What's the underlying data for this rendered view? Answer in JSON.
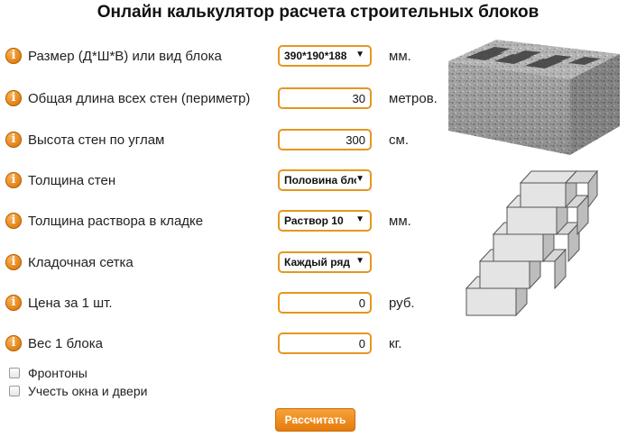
{
  "title": "Онлайн калькулятор расчета строительных блоков",
  "rows": [
    {
      "label": "Размер (Д*Ш*В) или вид блока",
      "type": "select",
      "value": "390*190*188",
      "unit": "мм."
    },
    {
      "label": "Общая длина всех стен (периметр)",
      "type": "input",
      "value": "30",
      "unit": "метров."
    },
    {
      "label": "Высота стен по углам",
      "type": "input",
      "value": "300",
      "unit": "см."
    },
    {
      "label": "Толщина стен",
      "type": "select",
      "value": "Половина блока",
      "unit": ""
    },
    {
      "label": "Толщина раствора в кладке",
      "type": "select",
      "value": "Раствор 10",
      "unit": "мм."
    },
    {
      "label": "Кладочная сетка",
      "type": "select",
      "value": "Каждый ряд",
      "unit": ""
    },
    {
      "label": "Цена за 1 шт.",
      "type": "input",
      "value": "0",
      "unit": "руб."
    },
    {
      "label": "Вес 1 блока",
      "type": "input",
      "value": "0",
      "unit": "кг."
    }
  ],
  "checkboxes": [
    {
      "label": "Фронтоны",
      "checked": false
    },
    {
      "label": "Учесть окна и двери",
      "checked": false
    }
  ],
  "button_label": "Рассчитать",
  "icons": {
    "info": "info-icon",
    "dropdown": "chevron-down-icon"
  },
  "colors": {
    "accent": "#e8951f",
    "button": "#f08a17"
  }
}
